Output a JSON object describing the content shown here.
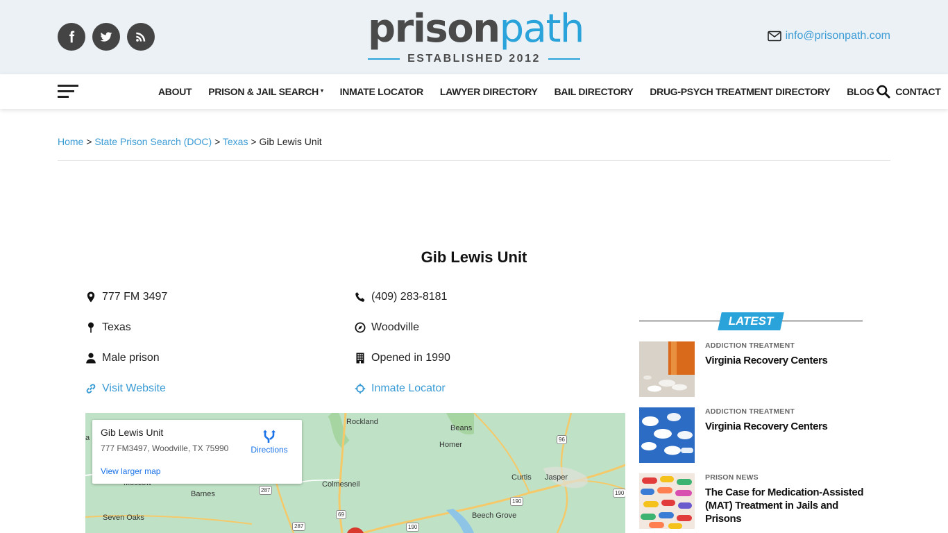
{
  "header": {
    "social": [
      {
        "icon": "facebook-icon"
      },
      {
        "icon": "twitter-icon"
      },
      {
        "icon": "rss-icon"
      }
    ],
    "logo": {
      "word_dark": "prison",
      "word_blue": "path",
      "tagline": "ESTABLISHED 2012"
    },
    "email": "info@prisonpath.com",
    "colors": {
      "accent": "#29a3d9",
      "link": "#3a9bd5",
      "topbar_bg": "#ebf1f5"
    }
  },
  "nav": {
    "items": [
      {
        "label": "ABOUT",
        "dropdown": false
      },
      {
        "label": "PRISON & JAIL SEARCH",
        "dropdown": true
      },
      {
        "label": "INMATE LOCATOR",
        "dropdown": false
      },
      {
        "label": "LAWYER DIRECTORY",
        "dropdown": false
      },
      {
        "label": "BAIL DIRECTORY",
        "dropdown": false
      },
      {
        "label": "DRUG-PSYCH TREATMENT DIRECTORY",
        "dropdown": false
      },
      {
        "label": "BLOG",
        "dropdown": true
      },
      {
        "label": "CONTACT",
        "dropdown": false
      }
    ],
    "caret": "▾"
  },
  "breadcrumb": {
    "items": [
      "Home",
      "State Prison Search (DOC)",
      "Texas"
    ],
    "current": "Gib Lewis Unit",
    "separator": ">"
  },
  "facility": {
    "title": "Gib Lewis Unit",
    "address": "777 FM 3497",
    "phone": "(409) 283-8181",
    "state": "Texas",
    "city": "Woodville",
    "gender": "Male prison",
    "opened": "Opened in 1990",
    "website_label": "Visit Website",
    "locator_label": "Inmate Locator"
  },
  "map": {
    "card": {
      "name": "Gib Lewis Unit",
      "address": "777 FM3497, Woodville, TX 75990",
      "directions": "Directions",
      "larger_map": "View larger map"
    },
    "places": [
      "Rockland",
      "Beans",
      "Homer",
      "Moscow",
      "Colmesneil",
      "Curtis",
      "Jasper",
      "Barnes",
      "Seven Oaks",
      "Beech Grove",
      "a"
    ],
    "routes": [
      "96",
      "287",
      "69",
      "190",
      "190",
      "190",
      "287",
      "190"
    ]
  },
  "sidebar": {
    "latest_label": "LATEST",
    "posts": [
      {
        "category": "ADDICTION TREATMENT",
        "title": "Virginia Recovery Centers"
      },
      {
        "category": "ADDICTION TREATMENT",
        "title": "Virginia Recovery Centers"
      },
      {
        "category": "PRISON NEWS",
        "title": "The Case for Medication-Assisted (MAT) Treatment in Jails and Prisons"
      }
    ]
  }
}
